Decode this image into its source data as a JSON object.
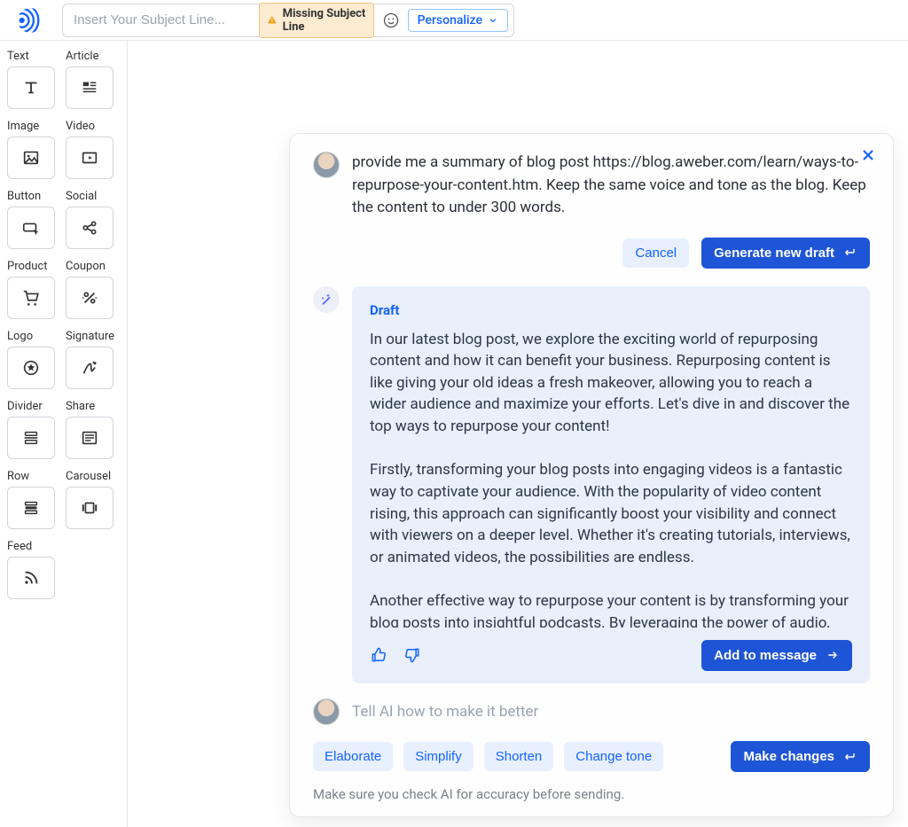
{
  "topbar": {
    "subject_placeholder": "Insert Your Subject Line...",
    "warning_label": "Missing Subject Line",
    "personalize_label": "Personalize"
  },
  "sidebar": {
    "items": [
      {
        "label": "Text",
        "icon": "text-icon"
      },
      {
        "label": "Article",
        "icon": "article-icon"
      },
      {
        "label": "Image",
        "icon": "image-icon"
      },
      {
        "label": "Video",
        "icon": "video-icon"
      },
      {
        "label": "Button",
        "icon": "button-icon"
      },
      {
        "label": "Social",
        "icon": "social-icon"
      },
      {
        "label": "Product",
        "icon": "product-icon"
      },
      {
        "label": "Coupon",
        "icon": "coupon-icon"
      },
      {
        "label": "Logo",
        "icon": "logo-icon"
      },
      {
        "label": "Signature",
        "icon": "signature-icon"
      },
      {
        "label": "Divider",
        "icon": "divider-icon"
      },
      {
        "label": "Share",
        "icon": "share-icon"
      },
      {
        "label": "Row",
        "icon": "row-icon"
      },
      {
        "label": "Carousel",
        "icon": "carousel-icon"
      },
      {
        "label": "Feed",
        "icon": "feed-icon"
      }
    ]
  },
  "ai": {
    "prompt": "provide me a summary of blog post https://blog.aweber.com/learn/ways-to-repurpose-your-content.htm. Keep the same voice and tone as the blog. Keep the content to under 300 words.",
    "cancel_label": "Cancel",
    "generate_label": "Generate new draft",
    "draft_title": "Draft",
    "draft_body": "In our latest blog post, we explore the exciting world of repurposing content and how it can benefit your business. Repurposing content is like giving your old ideas a fresh makeover, allowing you to reach a wider audience and maximize your efforts. Let's dive in and discover the top ways to repurpose your content!\n\nFirstly, transforming your blog posts into engaging videos is a fantastic way to captivate your audience. With the popularity of video content rising, this approach can significantly boost your visibility and connect with viewers on a deeper level. Whether it's creating tutorials, interviews, or animated videos, the possibilities are endless.\n\nAnother effective way to repurpose your content is by transforming your blog posts into insightful podcasts. By leveraging the power of audio, you can reach a whole new audience who prefer to consume content on-the-go.",
    "add_label": "Add to message",
    "followup_placeholder": "Tell AI how to make it better",
    "chips": [
      "Elaborate",
      "Simplify",
      "Shorten",
      "Change tone"
    ],
    "make_changes_label": "Make changes",
    "disclaimer": "Make sure you check AI for accuracy before sending."
  }
}
